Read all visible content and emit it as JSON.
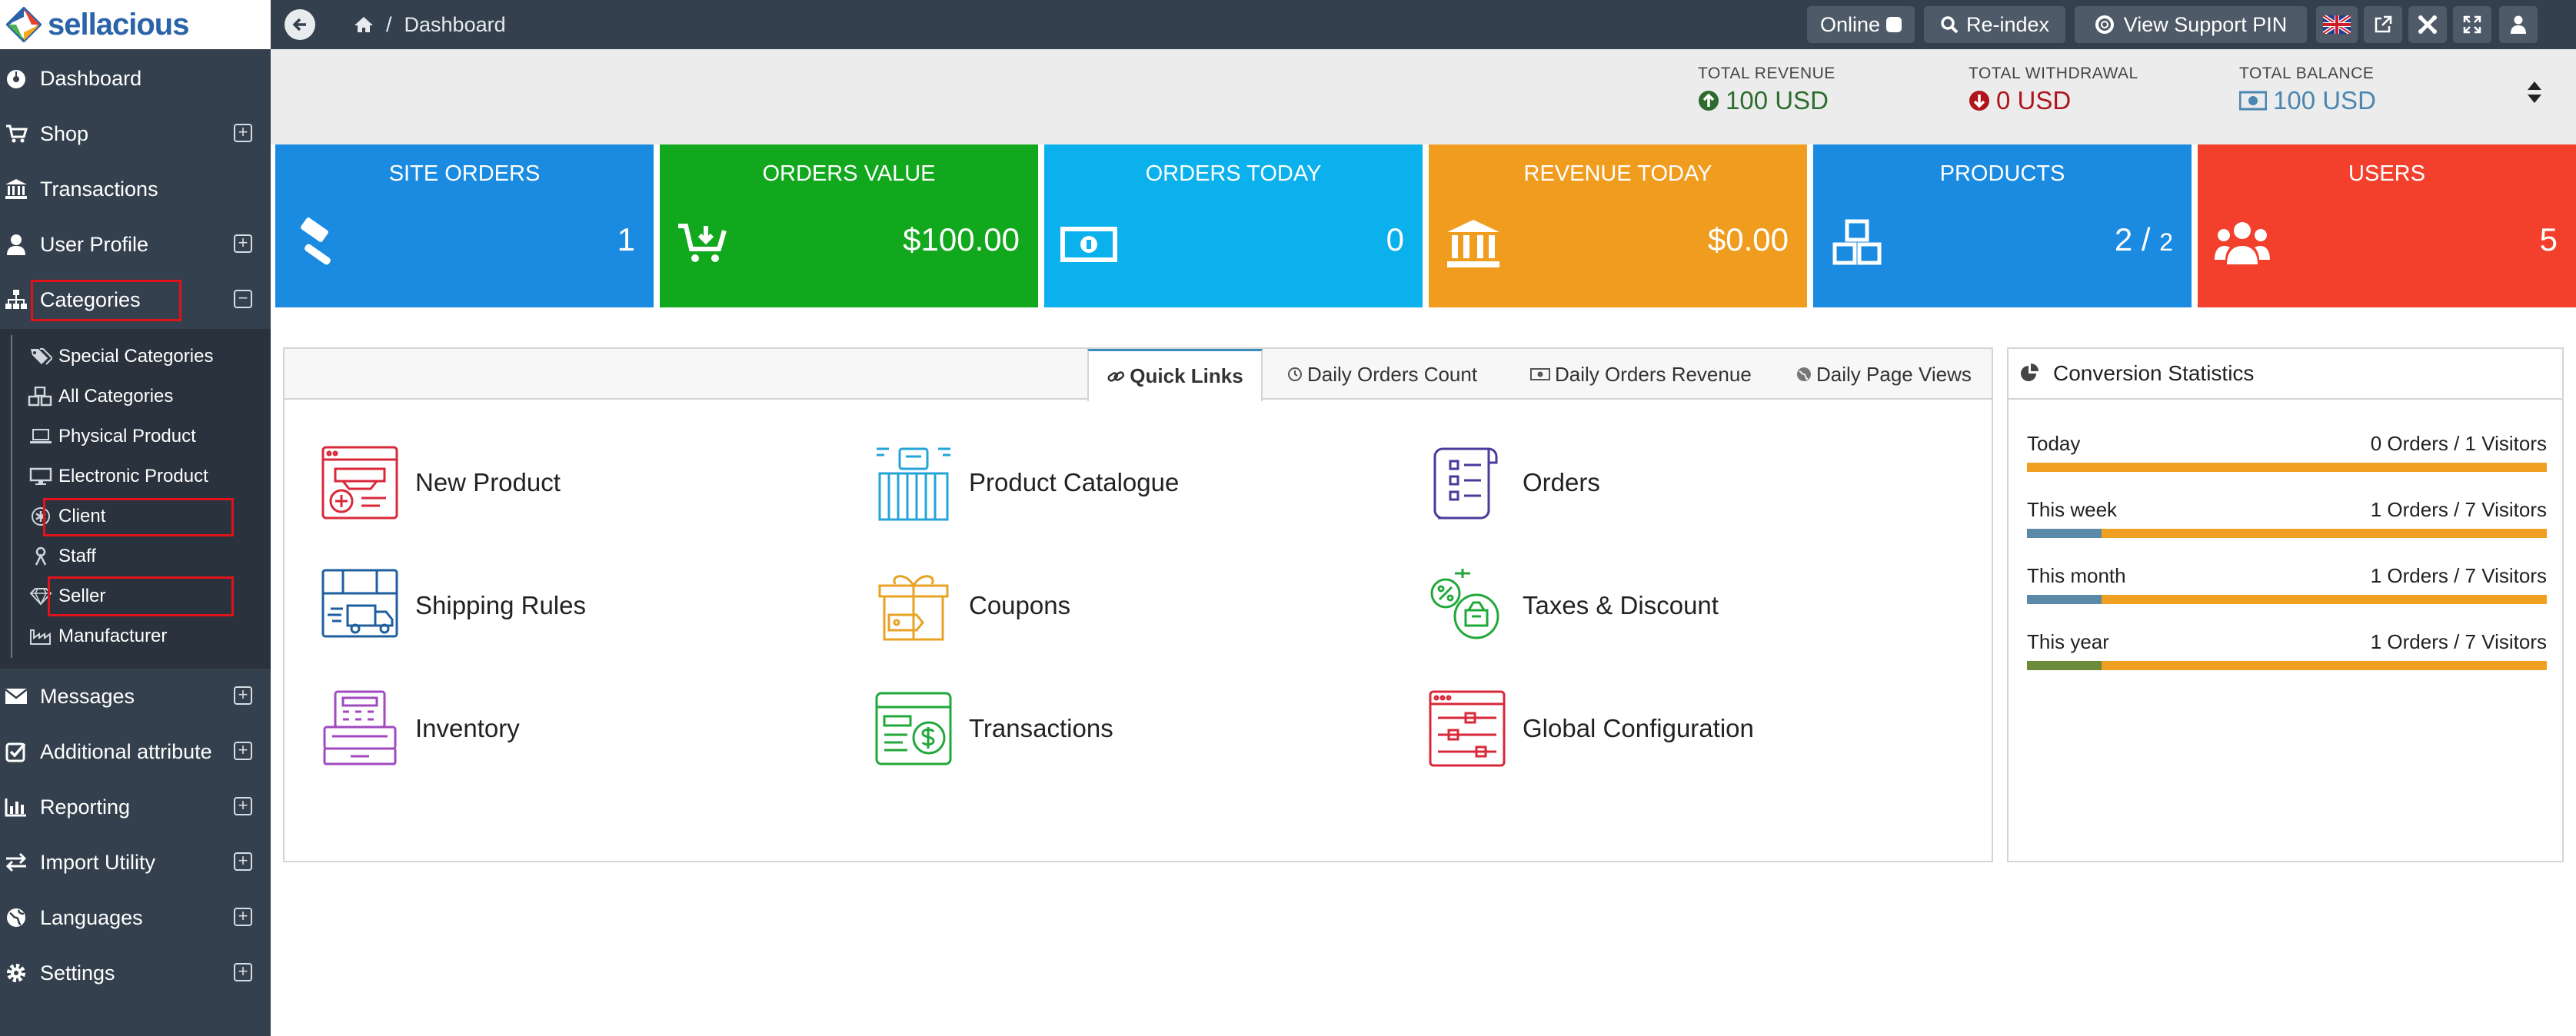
{
  "brand": {
    "name": "sellacious"
  },
  "sidebar": {
    "items": [
      {
        "label": "Dashboard",
        "icon": "dashboard-icon"
      },
      {
        "label": "Shop",
        "icon": "cart-icon"
      },
      {
        "label": "Transactions",
        "icon": "bank-icon"
      },
      {
        "label": "User Profile",
        "icon": "user-icon"
      },
      {
        "label": "Categories",
        "icon": "sitemap-icon"
      },
      {
        "label": "Messages",
        "icon": "envelope-icon"
      },
      {
        "label": "Additional attribute",
        "icon": "checkbox-icon"
      },
      {
        "label": "Reporting",
        "icon": "bar-chart-icon"
      },
      {
        "label": "Import Utility",
        "icon": "exchange-icon"
      },
      {
        "label": "Languages",
        "icon": "globe-icon"
      },
      {
        "label": "Settings",
        "icon": "gear-icon"
      }
    ],
    "expand_symbol": "+",
    "collapse_symbol": "−",
    "submenu": [
      {
        "label": "Special Categories",
        "icon": "tags-icon"
      },
      {
        "label": "All Categories",
        "icon": "cubes-icon"
      },
      {
        "label": "Physical Product",
        "icon": "laptop-icon"
      },
      {
        "label": "Electronic Product",
        "icon": "desktop-icon"
      },
      {
        "label": "Client",
        "icon": "asterisk-icon"
      },
      {
        "label": "Staff",
        "icon": "female-icon"
      },
      {
        "label": "Seller",
        "icon": "diamond-icon"
      },
      {
        "label": "Manufacturer",
        "icon": "industry-icon"
      }
    ]
  },
  "topbar": {
    "breadcrumb_sep": "/",
    "breadcrumb_current": "Dashboard",
    "online_label": "Online",
    "reindex_label": "Re-index",
    "support_label": "View Support PIN"
  },
  "totals": {
    "revenue": {
      "label": "TOTAL REVENUE",
      "value": "100 USD",
      "color": "#2e6b2e"
    },
    "withdrawal": {
      "label": "TOTAL WITHDRAWAL",
      "value": "0 USD",
      "color": "#b0141c"
    },
    "balance": {
      "label": "TOTAL BALANCE",
      "value": "100 USD",
      "color": "#4a86b0"
    }
  },
  "stats": [
    {
      "title": "SITE ORDERS",
      "value": "1",
      "color": "#1a8be0"
    },
    {
      "title": "ORDERS VALUE",
      "value": "$100.00",
      "color": "#12a81e"
    },
    {
      "title": "ORDERS TODAY",
      "value": "0",
      "color": "#0bb1ec"
    },
    {
      "title": "REVENUE TODAY",
      "value": "$0.00",
      "color": "#f09c1e"
    },
    {
      "title": "PRODUCTS",
      "value": "2 /",
      "value_small": "2",
      "color": "#1a8be0"
    },
    {
      "title": "USERS",
      "value": "5",
      "color": "#f2402c"
    }
  ],
  "quick_links": {
    "tabs": [
      {
        "label": "Quick Links",
        "icon": "link-icon"
      },
      {
        "label": "Daily Orders Count",
        "icon": "clock-icon"
      },
      {
        "label": "Daily Orders Revenue",
        "icon": "money-icon"
      },
      {
        "label": "Daily Page Views",
        "icon": "globe-icon"
      }
    ],
    "links": [
      {
        "label": "New Product"
      },
      {
        "label": "Product Catalogue"
      },
      {
        "label": "Orders"
      },
      {
        "label": "Shipping Rules"
      },
      {
        "label": "Coupons"
      },
      {
        "label": "Taxes & Discount"
      },
      {
        "label": "Inventory"
      },
      {
        "label": "Transactions"
      },
      {
        "label": "Global Configuration"
      }
    ]
  },
  "conversion": {
    "title": "Conversion Statistics",
    "rows": [
      {
        "period": "Today",
        "text": "0 Orders / 1 Visitors",
        "fraction": 0,
        "fill_color": "#5a8aa8"
      },
      {
        "period": "This week",
        "text": "1 Orders / 7 Visitors",
        "fraction": 0.143,
        "fill_color": "#5a8aa8"
      },
      {
        "period": "This month",
        "text": "1 Orders / 7 Visitors",
        "fraction": 0.143,
        "fill_color": "#5a8aa8"
      },
      {
        "period": "This year",
        "text": "1 Orders / 7 Visitors",
        "fraction": 0.143,
        "fill_color": "#6b8a3a"
      }
    ],
    "bar_color": "#f0a020"
  }
}
